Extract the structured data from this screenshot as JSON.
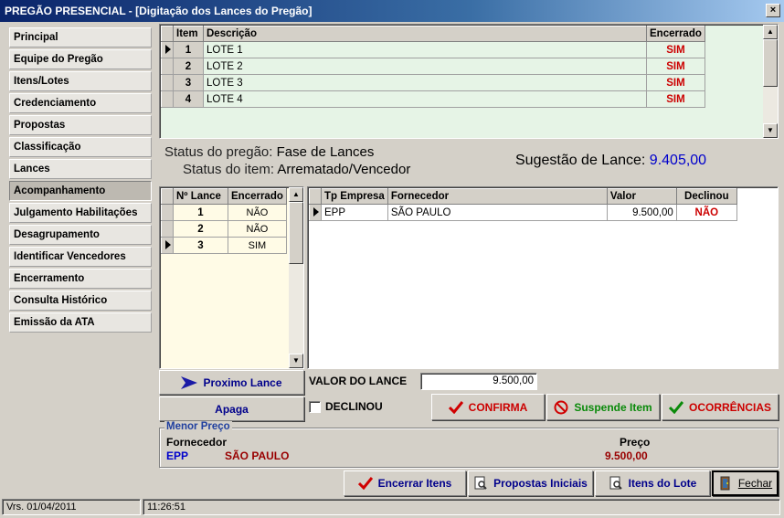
{
  "window": {
    "title": "PREGÃO PRESENCIAL - [Digitação dos Lances do Pregão]",
    "close_glyph": "×"
  },
  "sidebar": {
    "items": [
      {
        "label": "Principal"
      },
      {
        "label": "Equipe do Pregão"
      },
      {
        "label": "Itens/Lotes"
      },
      {
        "label": "Credenciamento"
      },
      {
        "label": "Propostas"
      },
      {
        "label": "Classificação"
      },
      {
        "label": "Lances"
      },
      {
        "label": "Acompanhamento",
        "active": true
      },
      {
        "label": "Julgamento Habilitações"
      },
      {
        "label": "Desagrupamento"
      },
      {
        "label": "Identificar Vencedores"
      },
      {
        "label": "Encerramento"
      },
      {
        "label": "Consulta Histórico"
      },
      {
        "label": "Emissão da ATA"
      }
    ]
  },
  "items_grid": {
    "headers": {
      "item": "Item",
      "descricao": "Descrição",
      "encerrado": "Encerrado"
    },
    "rows": [
      {
        "item": "1",
        "descricao": "LOTE 1",
        "encerrado": "SIM"
      },
      {
        "item": "2",
        "descricao": "LOTE 2",
        "encerrado": "SIM"
      },
      {
        "item": "3",
        "descricao": "LOTE 3",
        "encerrado": "SIM"
      },
      {
        "item": "4",
        "descricao": "LOTE 4",
        "encerrado": "SIM"
      }
    ]
  },
  "status": {
    "pregao_label": "Status do pregão:",
    "pregao_value": "Fase de Lances",
    "item_label": "Status do item:",
    "item_value": "Arrematado/Vencedor",
    "sugestao_label": "Sugestão de Lance:",
    "sugestao_value": "9.405,00"
  },
  "lances_grid": {
    "headers": {
      "lance": "Nº Lance",
      "encerrado": "Encerrado"
    },
    "rows": [
      {
        "lance": "1",
        "encerrado": "NÃO"
      },
      {
        "lance": "2",
        "encerrado": "NÃO"
      },
      {
        "lance": "3",
        "encerrado": "SIM"
      }
    ]
  },
  "fornecedores_grid": {
    "headers": {
      "tp_empresa": "Tp Empresa",
      "fornecedor": "Fornecedor",
      "valor": "Valor",
      "declinou": "Declinou"
    },
    "rows": [
      {
        "tp_empresa": "EPP",
        "fornecedor": "SÃO PAULO",
        "valor": "9.500,00",
        "declinou": "NÃO"
      }
    ]
  },
  "actions": {
    "proximo_lance": "Proximo Lance",
    "apaga": "Apaga",
    "valor_lance_label": "VALOR DO LANCE",
    "valor_lance_value": "9.500,00",
    "declinou_label": "DECLINOU",
    "confirma": "CONFIRMA",
    "suspende": "Suspende Item",
    "ocorrencias": "OCORRÊNCIAS"
  },
  "menor_preco": {
    "title": "Menor Preço",
    "fornecedor_label": "Fornecedor",
    "preco_label": "Preço",
    "tipo": "EPP",
    "fornecedor": "SÃO PAULO",
    "preco": "9.500,00"
  },
  "bottom_buttons": {
    "encerrar_itens": "Encerrar Itens",
    "propostas_iniciais": "Propostas Iniciais",
    "itens_do_lote": "Itens do Lote",
    "fechar": "Fechar"
  },
  "statusbar": {
    "version": "Vrs. 01/04/2011",
    "time": "11:26:51"
  },
  "colors": {
    "accent_red": "#cc0000",
    "accent_green": "#0a8a0a",
    "blue_text": "#0000cc"
  }
}
